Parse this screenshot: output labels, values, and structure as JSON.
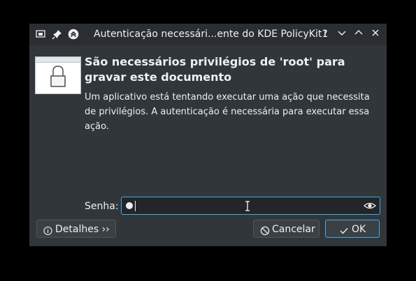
{
  "window": {
    "title": "Autenticação necessári...ente do KDE PolicyKit1",
    "help_glyph": "?",
    "icons": [
      "pin-icon",
      "keep-above-icon",
      "app-icon",
      "help-icon",
      "minimize-icon",
      "maximize-icon",
      "close-icon"
    ]
  },
  "dialog": {
    "heading": "São necessários privilégios de 'root' para gravar este documento",
    "description": "Um aplicativo está tentando executar uma ação que necessita de privilégios. A autenticação é necessária para executar essa ação.",
    "password_label": "Senha:",
    "password_value": "•"
  },
  "buttons": {
    "details_label": "Detalhes ››",
    "cancel_label": "Cancelar",
    "ok_label": "OK"
  },
  "colors": {
    "window_bg": "#31363b",
    "titlebar_bg": "#2a2e32",
    "accent": "#3daee9",
    "text": "#eff0f1"
  }
}
